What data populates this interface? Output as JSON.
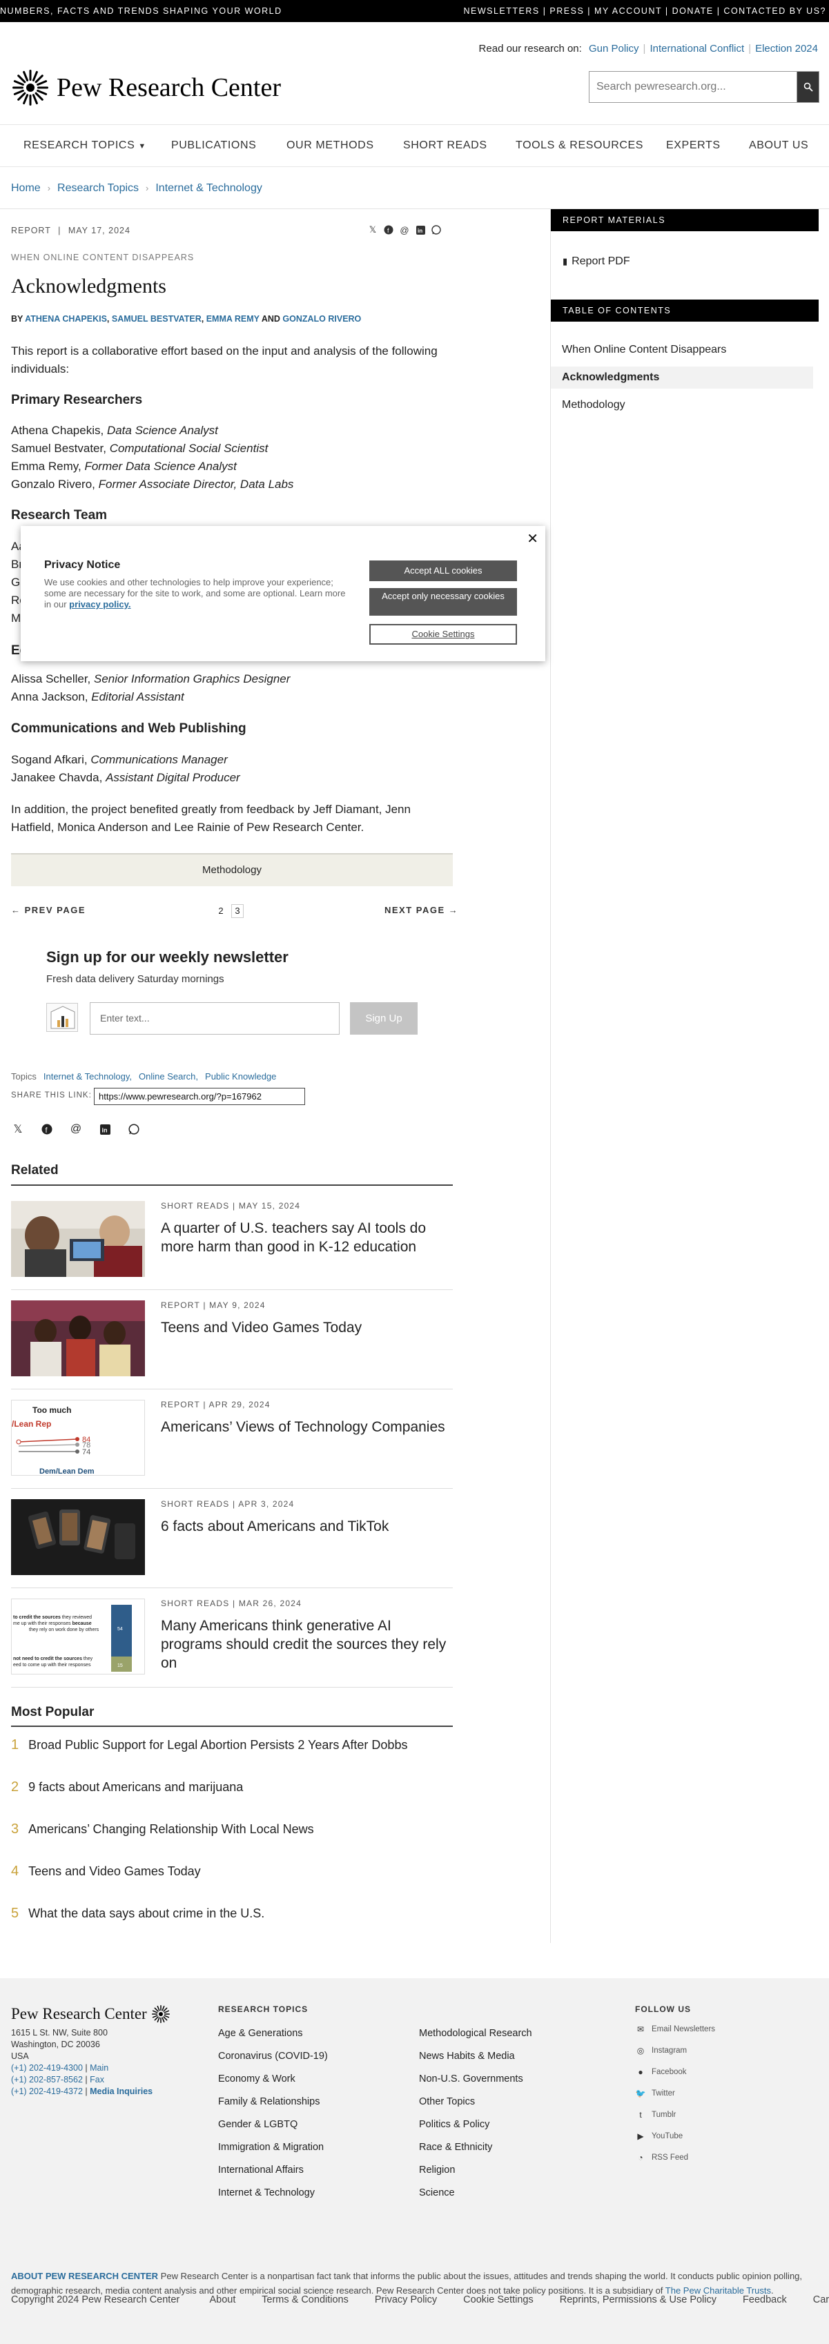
{
  "topbar": {
    "left": "NUMBERS, FACTS AND TRENDS SHAPING YOUR WORLD",
    "right": "NEWSLETTERS | PRESS | MY ACCOUNT | DONATE | CONTACTED BY US?"
  },
  "research_on": {
    "label": "Read our research on:",
    "links": [
      "Gun Policy",
      "International Conflict",
      "Election 2024"
    ]
  },
  "brand": {
    "name": "Pew Research Center"
  },
  "search": {
    "placeholder": "Search pewresearch.org..."
  },
  "nav": [
    "RESEARCH TOPICS",
    "PUBLICATIONS",
    "OUR METHODS",
    "SHORT READS",
    "TOOLS & RESOURCES",
    "EXPERTS",
    "ABOUT US"
  ],
  "breadcrumb": [
    "Home",
    "Research Topics",
    "Internet & Technology"
  ],
  "article": {
    "type": "REPORT",
    "date": "MAY 17, 2024",
    "kicker": "WHEN ONLINE CONTENT DISAPPEARS",
    "title": "Acknowledgments",
    "byline_prefix": "BY",
    "authors": [
      "ATHENA CHAPEKIS",
      "SAMUEL BESTVATER",
      "EMMA REMY",
      "GONZALO RIVERO"
    ],
    "byline_and": "AND",
    "intro": "This report is a collaborative effort based on the input and analysis of the following individuals:",
    "primary_heading": "Primary Researchers",
    "primary": [
      {
        "name": "Athena Chapekis,",
        "role": "Data Science Analyst"
      },
      {
        "name": "Samuel Bestvater,",
        "role": "Computational Social Scientist"
      },
      {
        "name": "Emma Remy,",
        "role": "Former Data Science Analyst"
      },
      {
        "name": "Gonzalo Rivero,",
        "role": "Former Associate Director, Data Labs"
      }
    ],
    "team_heading": "Research Team",
    "team_partial": [
      "Aa",
      "Br",
      "Ga",
      "Re",
      "Me"
    ],
    "editorial_partial": "Ed",
    "editorial": [
      {
        "name": "Alissa Scheller,",
        "role": "Senior Information Graphics Designer"
      },
      {
        "name": "Anna Jackson,",
        "role": "Editorial Assistant"
      }
    ],
    "comms_heading": "Communications and Web Publishing",
    "comms": [
      {
        "name": "Sogand Afkari,",
        "role": "Communications Manager"
      },
      {
        "name": "Janakee Chavda,",
        "role": "Assistant Digital Producer"
      }
    ],
    "closing": "In addition, the project benefited greatly from feedback by Jeff Diamant, Jenn Hatfield, Monica Anderson and Lee Rainie of Pew Research Center.",
    "next_section": "Methodology"
  },
  "pager": {
    "prev": "PREV PAGE",
    "next": "NEXT PAGE",
    "pages": [
      "2",
      "3"
    ]
  },
  "newsletter": {
    "title": "Sign up for our weekly newsletter",
    "subtitle": "Fresh data delivery Saturday mornings",
    "placeholder": "Enter text...",
    "button": "Sign Up"
  },
  "topics": {
    "label": "Topics",
    "items": [
      "Internet & Technology,",
      "Online Search,",
      "Public Knowledge"
    ]
  },
  "share_link": {
    "label": "SHARE THIS LINK:",
    "url": "https://www.pewresearch.org/?p=167962"
  },
  "related": {
    "heading": "Related",
    "items": [
      {
        "type": "SHORT READS",
        "date": "MAY 15, 2024",
        "title": "A quarter of U.S. teachers say AI tools do more harm than good in K-12 education"
      },
      {
        "type": "REPORT",
        "date": "MAY 9, 2024",
        "title": "Teens and Video Games Today"
      },
      {
        "type": "REPORT",
        "date": "APR 29, 2024",
        "title": "Americans’ Views of Technology Companies"
      },
      {
        "type": "SHORT READS",
        "date": "APR 3, 2024",
        "title": "6 facts about Americans and TikTok"
      },
      {
        "type": "SHORT READS",
        "date": "MAR 26, 2024",
        "title": "Many Americans think generative AI programs should credit the sources they rely on"
      }
    ],
    "thumb3": {
      "title": "Too much",
      "series": "/Lean Rep",
      "vals": [
        "84",
        "78",
        "74"
      ],
      "foot": "Dem/Lean Dem"
    },
    "thumb5": {
      "line1": "to credit the sources",
      "line1b": " they reviewed",
      "line2": "me up with their responses",
      "line2b": "because",
      "line3": "they rely on work done by others",
      "line4": "not need to credit the sources",
      "line4b": " they",
      "line5": "eed to come up with their responses",
      "v1": "54",
      "v2": "15"
    }
  },
  "popular": {
    "heading": "Most Popular",
    "items": [
      "Broad Public Support for Legal Abortion Persists 2 Years After Dobbs",
      "9 facts about Americans and marijuana",
      "Americans’ Changing Relationship With Local News",
      "Teens and Video Games Today",
      "What the data says about crime in the U.S."
    ]
  },
  "sidebar": {
    "materials_heading": "REPORT MATERIALS",
    "report_pdf": "Report PDF",
    "toc_heading": "TABLE OF CONTENTS",
    "toc": [
      "When Online Content Disappears",
      "Acknowledgments",
      "Methodology"
    ]
  },
  "privacy": {
    "title": "Privacy Notice",
    "body": "We use cookies and other technologies to help improve your experience; some are necessary for the site to work, and some are optional. Learn more in our",
    "link": "privacy policy.",
    "accept_all": "Accept ALL cookies",
    "accept_necessary": "Accept only necessary cookies",
    "settings": "Cookie Settings"
  },
  "footer": {
    "address": [
      "1615 L St. NW, Suite 800",
      "Washington, DC 20036",
      "USA"
    ],
    "phones": [
      {
        "num": "(+1) 202-419-4300",
        "label": "Main"
      },
      {
        "num": "(+1) 202-857-8562",
        "label": "Fax"
      },
      {
        "num": "(+1) 202-419-4372",
        "label": "Media Inquiries"
      }
    ],
    "topics_heading": "RESEARCH TOPICS",
    "topics_col1": [
      "Age & Generations",
      "Coronavirus (COVID-19)",
      "Economy & Work",
      "Family & Relationships",
      "Gender & LGBTQ",
      "Immigration & Migration",
      "International Affairs",
      "Internet & Technology"
    ],
    "topics_col2": [
      "Methodological Research",
      "News Habits & Media",
      "Non-U.S. Governments",
      "Other Topics",
      "Politics & Policy",
      "Race & Ethnicity",
      "Religion",
      "Science"
    ],
    "follow_heading": "FOLLOW US",
    "follow": [
      "Email Newsletters",
      "Instagram",
      "Facebook",
      "Twitter",
      "Tumblr",
      "YouTube",
      "RSS Feed"
    ],
    "about_label": "ABOUT PEW RESEARCH CENTER",
    "about_text": " Pew Research Center is a nonpartisan fact tank that informs the public about the issues, attitudes and trends shaping the world. It conducts public opinion polling, demographic research, media content analysis and other empirical social science research. Pew Research Center does not take policy positions. It is a subsidiary of ",
    "about_link": "The Pew Charitable Trusts",
    "about_end": ".",
    "copyright": "Copyright 2024 Pew Research Center",
    "links": [
      "About",
      "Terms & Conditions",
      "Privacy Policy",
      "Cookie Settings",
      "Reprints, Permissions & Use Policy",
      "Feedback",
      "Careers"
    ]
  },
  "colors": {
    "link": "#2a6c9c",
    "accent_gold": "#c9a23a",
    "topbar": "#000000"
  }
}
